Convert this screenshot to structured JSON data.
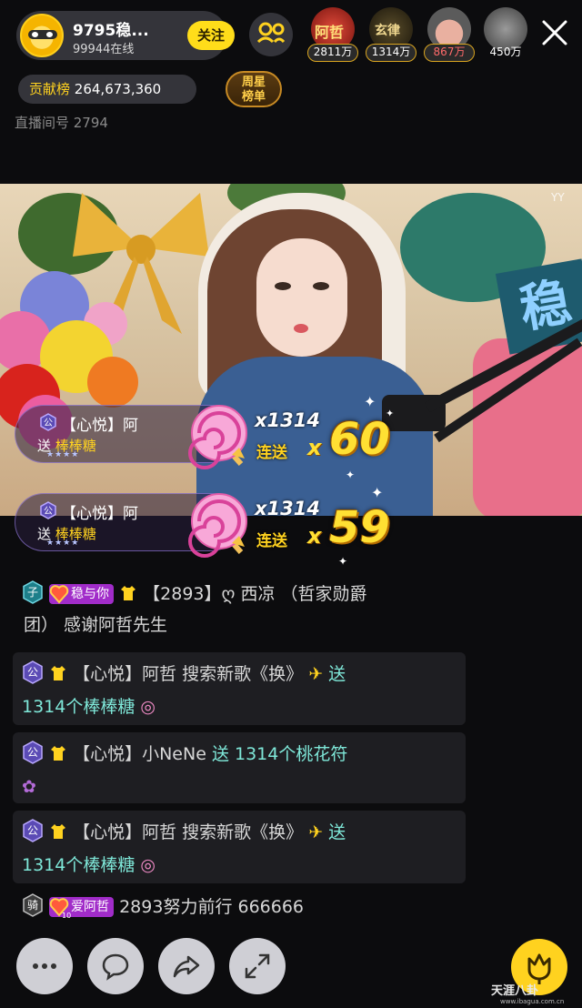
{
  "header": {
    "host_name": "9795稳...",
    "online": "99944在线",
    "follow_label": "关注",
    "viewers": [
      {
        "name": "阿哲",
        "count": "2811万",
        "color": "#c0392b"
      },
      {
        "name": "玄律",
        "count": "1314万",
        "color": "#3a3320"
      },
      {
        "name": "",
        "count": "867万",
        "color": "#b56b6b"
      },
      {
        "name": "",
        "count": "450万",
        "color": "#6f6f6f"
      }
    ],
    "contrib_label": "贡献榜",
    "contrib_value": "264,673,360",
    "weekly_line1": "周星",
    "weekly_line2": "榜单",
    "room_id": "直播间号 2794"
  },
  "video": {
    "sign_char": "稳",
    "watermark": "YY"
  },
  "gift_toasts": [
    {
      "badge": "公",
      "sender": "【心悦】阿",
      "send_word": "送",
      "gift": "棒棒糖",
      "stars": "★★★★",
      "times": "x1314",
      "combo_label": "连送",
      "combo_x": "x",
      "combo_count": "60"
    },
    {
      "badge": "公",
      "sender": "【心悦】阿",
      "send_word": "送",
      "gift": "棒棒糖",
      "stars": "★★★★",
      "times": "x1314",
      "combo_label": "连送",
      "combo_x": "x",
      "combo_count": "59"
    }
  ],
  "chat": {
    "line1": {
      "badge": "子",
      "medal": "稳与你",
      "text_a": "【2893】",
      "text_b": "西凉 （哲家勋爵",
      "text_c": "团） 感谢阿哲先生"
    },
    "boxes": [
      {
        "badge": "公",
        "user": "【心悦】阿哲 搜索新歌《换》",
        "action": "送",
        "line2": "1314个棒棒糖"
      },
      {
        "badge": "公",
        "user": "【心悦】小NeNe",
        "action": "送 1314个桃花符",
        "line2": ""
      },
      {
        "badge": "公",
        "user": "【心悦】阿哲 搜索新歌《换》",
        "action": "送",
        "line2": "1314个棒棒糖"
      }
    ],
    "last_line": {
      "badge": "骑",
      "medal_level": "10",
      "medal": "爱阿哲",
      "text": "2893努力前行 666666"
    }
  },
  "bottom": {
    "watermark": "天涯八卦",
    "watermark_url": "www.ibagua.com.cn"
  },
  "colors": {
    "accent_yellow": "#ffd21f",
    "combo_yellow": "#ffe033",
    "chat_cyan": "#7fe8d9",
    "medal_purple": "#a12cc9"
  }
}
